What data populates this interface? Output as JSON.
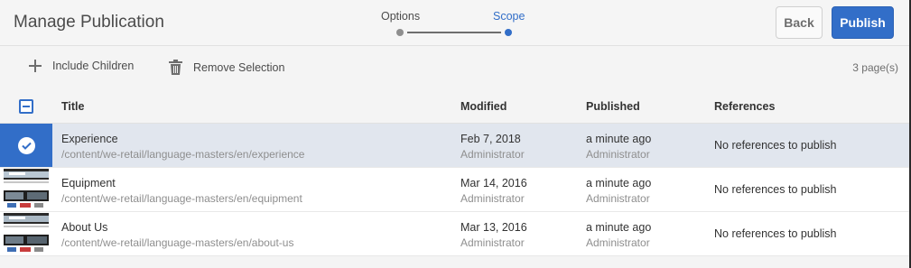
{
  "header": {
    "title": "Manage Publication",
    "steps": [
      {
        "label": "Options",
        "active": false
      },
      {
        "label": "Scope",
        "active": true
      }
    ],
    "back_label": "Back",
    "publish_label": "Publish"
  },
  "toolbar": {
    "include_children_label": "Include Children",
    "include_children_icon": "plus-icon",
    "remove_selection_label": "Remove Selection",
    "remove_selection_icon": "trash-icon",
    "page_count": "3 page(s)"
  },
  "table": {
    "columns": [
      "Title",
      "Modified",
      "Published",
      "References"
    ],
    "rows": [
      {
        "title": "Experience",
        "path": "/content/we-retail/language-masters/en/experience",
        "modified_date": "Feb 7, 2018",
        "modified_by": "Administrator",
        "published_date": "a minute ago",
        "published_by": "Administrator",
        "references": "No references to publish",
        "selected": true
      },
      {
        "title": "Equipment",
        "path": "/content/we-retail/language-masters/en/equipment",
        "modified_date": "Mar 14, 2016",
        "modified_by": "Administrator",
        "published_date": "a minute ago",
        "published_by": "Administrator",
        "references": "No references to publish",
        "selected": false
      },
      {
        "title": "About Us",
        "path": "/content/we-retail/language-masters/en/about-us",
        "modified_date": "Mar 13, 2016",
        "modified_by": "Administrator",
        "published_date": "a minute ago",
        "published_by": "Administrator",
        "references": "No references to publish",
        "selected": false
      }
    ]
  },
  "colors": {
    "accent": "#326ec8",
    "selected_row": "#e1e6ee"
  }
}
